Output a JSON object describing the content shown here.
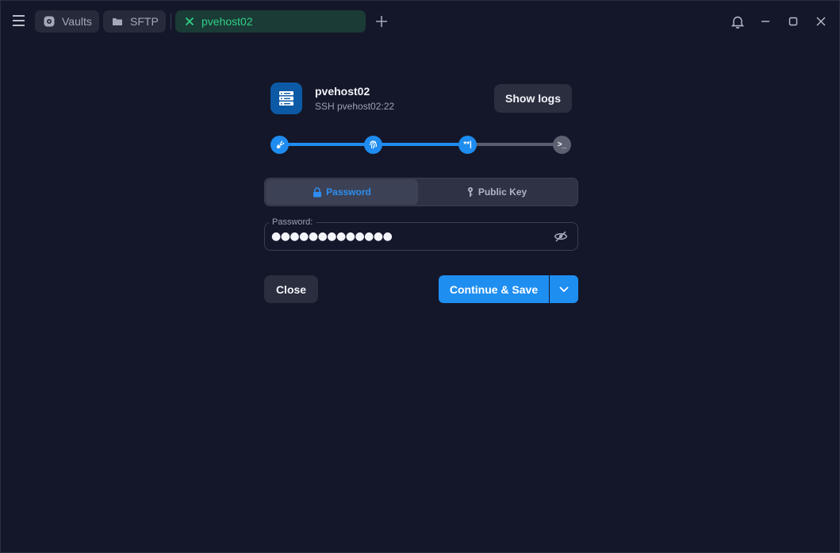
{
  "tabs": {
    "vaults_label": "Vaults",
    "sftp_label": "SFTP",
    "active_label": "pvehost02"
  },
  "host": {
    "name": "pvehost02",
    "subtitle": "SSH pvehost02:22",
    "show_logs_label": "Show logs"
  },
  "progress": {
    "steps": [
      "connect",
      "fingerprint",
      "password",
      "terminal"
    ],
    "current_step": 3,
    "password_step_glyph": "**|",
    "terminal_step_glyph": ">_"
  },
  "auth": {
    "password_tab_label": "Password",
    "public_key_tab_label": "Public Key",
    "selected": "Password"
  },
  "password_field": {
    "label": "Password:",
    "masked_value": "●●●●●●●●●●●●●"
  },
  "actions": {
    "close_label": "Close",
    "continue_label": "Continue & Save"
  },
  "colors": {
    "accent": "#1f8ef1",
    "active_tab_text": "#2fd087",
    "background": "#141729"
  }
}
